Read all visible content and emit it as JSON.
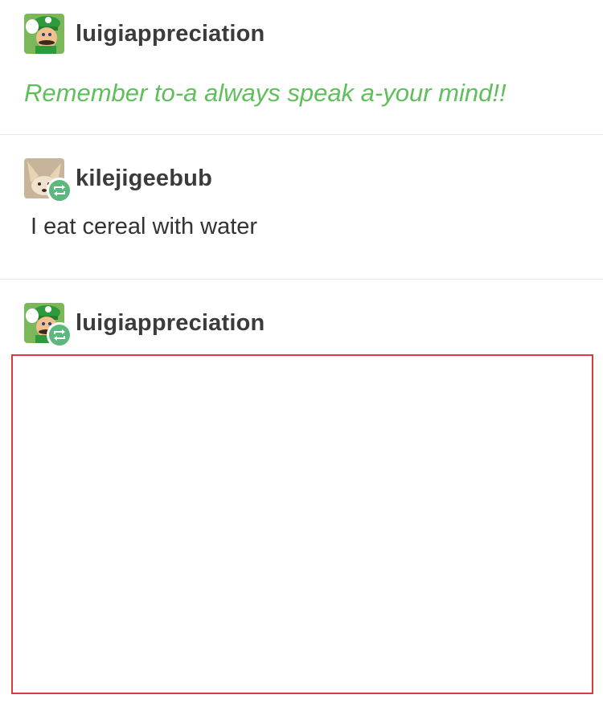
{
  "posts": [
    {
      "username": "luigiappreciation",
      "text": "Remember to-a always speak a-your mind!!",
      "avatar": "luigi-avatar",
      "reblog": false,
      "text_color": "#5fbf5a"
    },
    {
      "username": "kilejigeebub",
      "text": "I eat cereal with water",
      "avatar": "fox-avatar",
      "reblog": true
    },
    {
      "username": "luigiappreciation",
      "avatar": "luigi-avatar",
      "reblog": true,
      "highlight_color": "#d93a3a"
    }
  ],
  "colors": {
    "reblog_badge": "#5cb87d",
    "divider": "#e6e6e6"
  }
}
